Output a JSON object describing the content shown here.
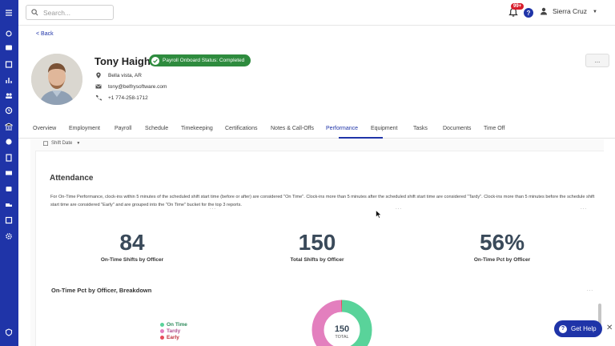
{
  "topbar": {
    "search_placeholder": "Search...",
    "notification_badge": "99+",
    "help_label": "?",
    "user_name": "Sierra Cruz"
  },
  "profile": {
    "back_label": "< Back",
    "name": "Tony Haigh",
    "status": "Payroll Onboard Status: Completed",
    "location": "Bella vista, AR",
    "email": "tony@belfrysoftware.com",
    "phone": "+1 774-258-1712",
    "more_label": "..."
  },
  "tabs": [
    {
      "label": "Overview"
    },
    {
      "label": "Employment"
    },
    {
      "label": "Payroll"
    },
    {
      "label": "Schedule"
    },
    {
      "label": "Timekeeping"
    },
    {
      "label": "Certifications"
    },
    {
      "label": "Notes & Call-Offs"
    },
    {
      "label": "Performance",
      "active": true
    },
    {
      "label": "Equipment"
    },
    {
      "label": "Tasks"
    },
    {
      "label": "Documents"
    },
    {
      "label": "Time Off"
    }
  ],
  "performance": {
    "filter_label": "Shift Date",
    "attendance_title": "Attendance",
    "attendance_description": "For On-Time Performance, clock-ins within 5 minutes of the scheduled shift start time (before or after) are considered \"On Time\". Clock-ins more than 5 minutes after the scheduled shift start time are considered \"Tardy\". Clock-ins more than 5 minutes before the schedule shift start time are considered \"Early\" and are grouped into the \"On Time\" bucket for the top 3 reports.",
    "kpis": [
      {
        "value": "84",
        "label": "On-Time Shifts by Officer"
      },
      {
        "value": "150",
        "label": "Total Shifts by Officer"
      },
      {
        "value": "56%",
        "label": "On-Time Pct by Officer"
      }
    ],
    "kebab": "...",
    "breakdown_title": "On-Time Pct by Officer, Breakdown",
    "legend": [
      {
        "label": "On Time",
        "color": "#59d39a"
      },
      {
        "label": "Tardy",
        "color": "#e37fbe"
      },
      {
        "label": "Early",
        "color": "#e74c5c"
      }
    ],
    "donut": {
      "total_value": "150",
      "total_label": "TOTAL",
      "segments": [
        {
          "name": "On Time",
          "value": 84,
          "color": "#59d39a"
        },
        {
          "name": "Tardy",
          "value": 65,
          "color": "#e37fbe"
        },
        {
          "name": "Early",
          "value": 1,
          "color": "#e74c5c"
        }
      ]
    }
  },
  "floating": {
    "get_help_icon": "?",
    "get_help_label": "Get Help",
    "close_label": "✕"
  },
  "colors": {
    "brand": "#1f34a8",
    "status_green": "#2e8b3e"
  }
}
